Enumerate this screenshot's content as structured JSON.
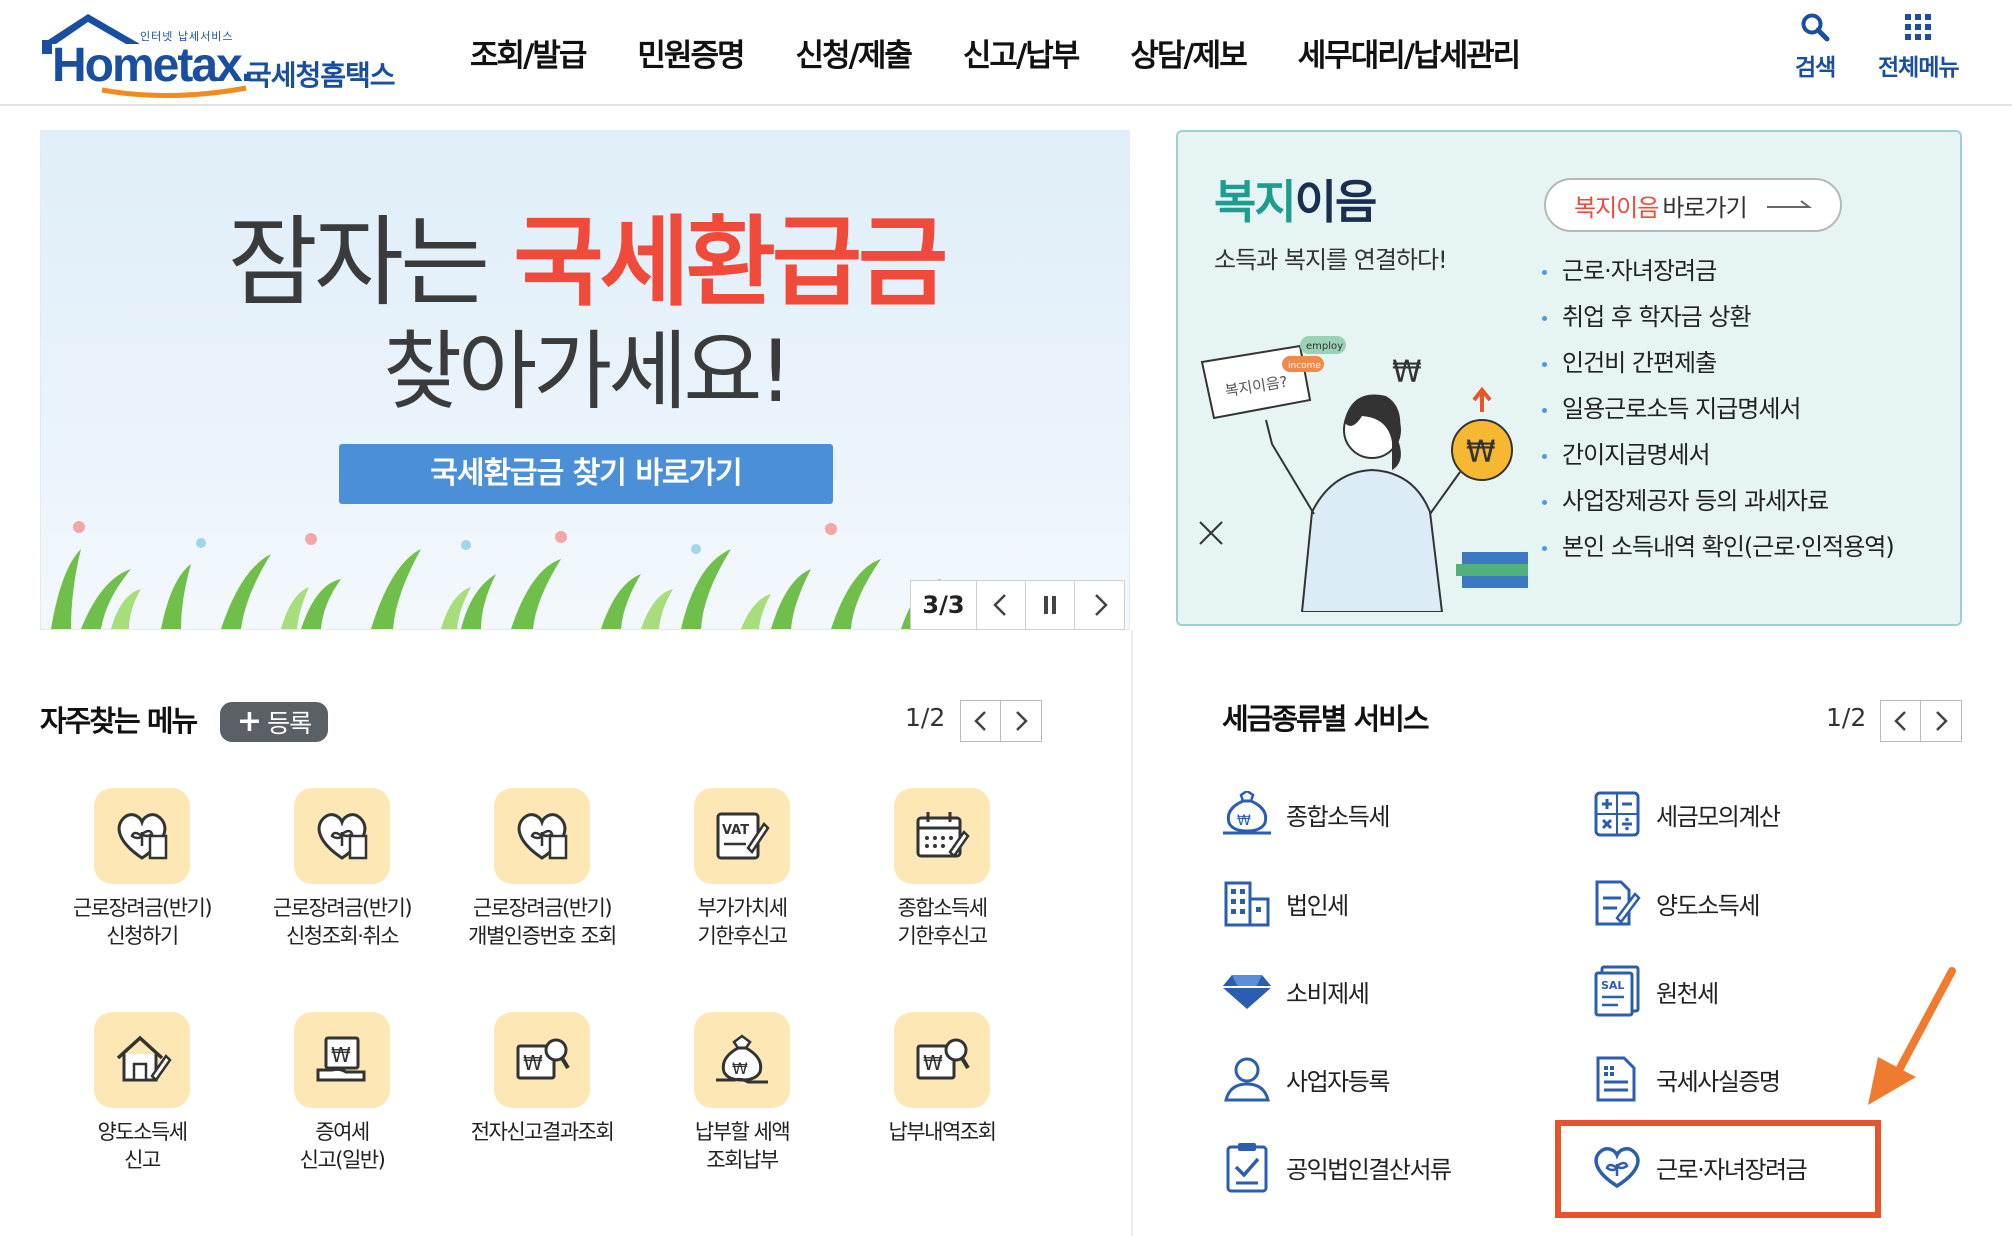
{
  "header": {
    "logo_small": "인터넷 납세서비스",
    "logo_main": "Hometax.",
    "logo_kr": "국세청홈택스",
    "nav": [
      "조회/발급",
      "민원증명",
      "신청/제출",
      "신고/납부",
      "상담/제보",
      "세무대리/납세관리"
    ],
    "search_label": "검색",
    "allmenu_label": "전체메뉴"
  },
  "hero": {
    "line1_dark": "잠자는 ",
    "line1_red": "국세환급금",
    "line2": "찾아가세요!",
    "button": "국세환급금 찾기 바로가기",
    "slide_count": "3/3"
  },
  "welfare": {
    "title_a": "복지",
    "title_b": "이음",
    "subtitle": "소득과 복지를 연결하다!",
    "link_red": "복지이음",
    "link_rest": "바로가기",
    "items": [
      "근로·자녀장려금",
      "취업 후 학자금 상환",
      "인건비 간편제출",
      "일용근로소득 지급명세서",
      "간이지급명세서",
      "사업장제공자 등의 과세자료",
      "본인 소득내역 확인(근로·인적용역)"
    ],
    "illu_sign": "복지이음?",
    "illu_tag1": "employ",
    "illu_tag2": "income"
  },
  "frequent": {
    "title": "자주찾는 메뉴",
    "register": "등록",
    "page": "1/2",
    "tiles": [
      {
        "label": "근로장려금(반기)\n신청하기",
        "icon": "heart-plant-icon"
      },
      {
        "label": "근로장려금(반기)\n신청조회·취소",
        "icon": "heart-plant-icon"
      },
      {
        "label": "근로장려금(반기)\n개별인증번호 조회",
        "icon": "heart-plant-icon"
      },
      {
        "label": "부가가치세\n기한후신고",
        "icon": "vat-document-icon"
      },
      {
        "label": "종합소득세\n기한후신고",
        "icon": "calendar-icon"
      },
      {
        "label": "양도소득세\n신고",
        "icon": "house-pen-icon"
      },
      {
        "label": "증여세\n신고(일반)",
        "icon": "gift-won-icon"
      },
      {
        "label": "전자신고결과조회",
        "icon": "won-search-icon"
      },
      {
        "label": "납부할 세액\n조회납부",
        "icon": "money-bag-icon"
      },
      {
        "label": "납부내역조회",
        "icon": "won-search-icon"
      }
    ]
  },
  "services": {
    "title": "세금종류별 서비스",
    "page": "1/2",
    "items": [
      {
        "label": "종합소득세",
        "icon": "money-bag-icon"
      },
      {
        "label": "세금모의계산",
        "icon": "calculator-icon"
      },
      {
        "label": "법인세",
        "icon": "building-icon"
      },
      {
        "label": "양도소득세",
        "icon": "document-pen-icon"
      },
      {
        "label": "소비제세",
        "icon": "diamond-icon"
      },
      {
        "label": "원천세",
        "icon": "salary-document-icon"
      },
      {
        "label": "사업자등록",
        "icon": "person-icon"
      },
      {
        "label": "국세사실증명",
        "icon": "certificate-icon"
      },
      {
        "label": "공익법인결산서류",
        "icon": "clipboard-check-icon"
      },
      {
        "label": "근로·자녀장려금",
        "icon": "heart-plant-icon"
      }
    ]
  },
  "colors": {
    "brand_blue": "#1a4fa0",
    "hero_red": "#ef4a3a",
    "welfare_teal": "#1b9d8f",
    "highlight_orange": "#e8542a",
    "tile_yellow": "#fde7b4"
  }
}
